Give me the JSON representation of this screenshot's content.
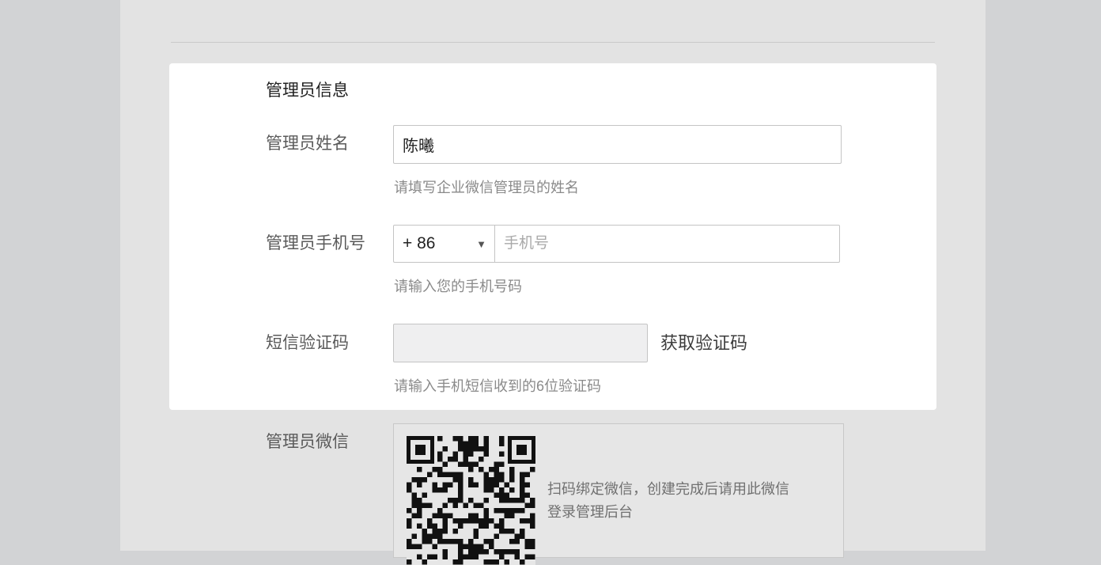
{
  "form": {
    "section_title": "管理员信息",
    "name": {
      "label": "管理员姓名",
      "value": "陈曦",
      "hint": "请填写企业微信管理员的姓名"
    },
    "phone": {
      "label": "管理员手机号",
      "country_code": "+ 86",
      "placeholder": "手机号",
      "hint": "请输入您的手机号码"
    },
    "sms": {
      "label": "短信验证码",
      "value": "",
      "get_code_label": "获取验证码",
      "hint": "请输入手机短信收到的6位验证码"
    },
    "wechat": {
      "label": "管理员微信",
      "qr_text_line1": "扫码绑定微信，创建完成后请用此微信",
      "qr_text_line2": "登录管理后台"
    }
  },
  "icons": {
    "dropdown": "caret-down-icon",
    "qr": "qr-code-icon"
  },
  "colors": {
    "background": "#d2d3d5",
    "panel": "#e3e3e3",
    "card": "#ffffff",
    "label": "#5a5a5a",
    "hint": "#8a8a8a"
  }
}
